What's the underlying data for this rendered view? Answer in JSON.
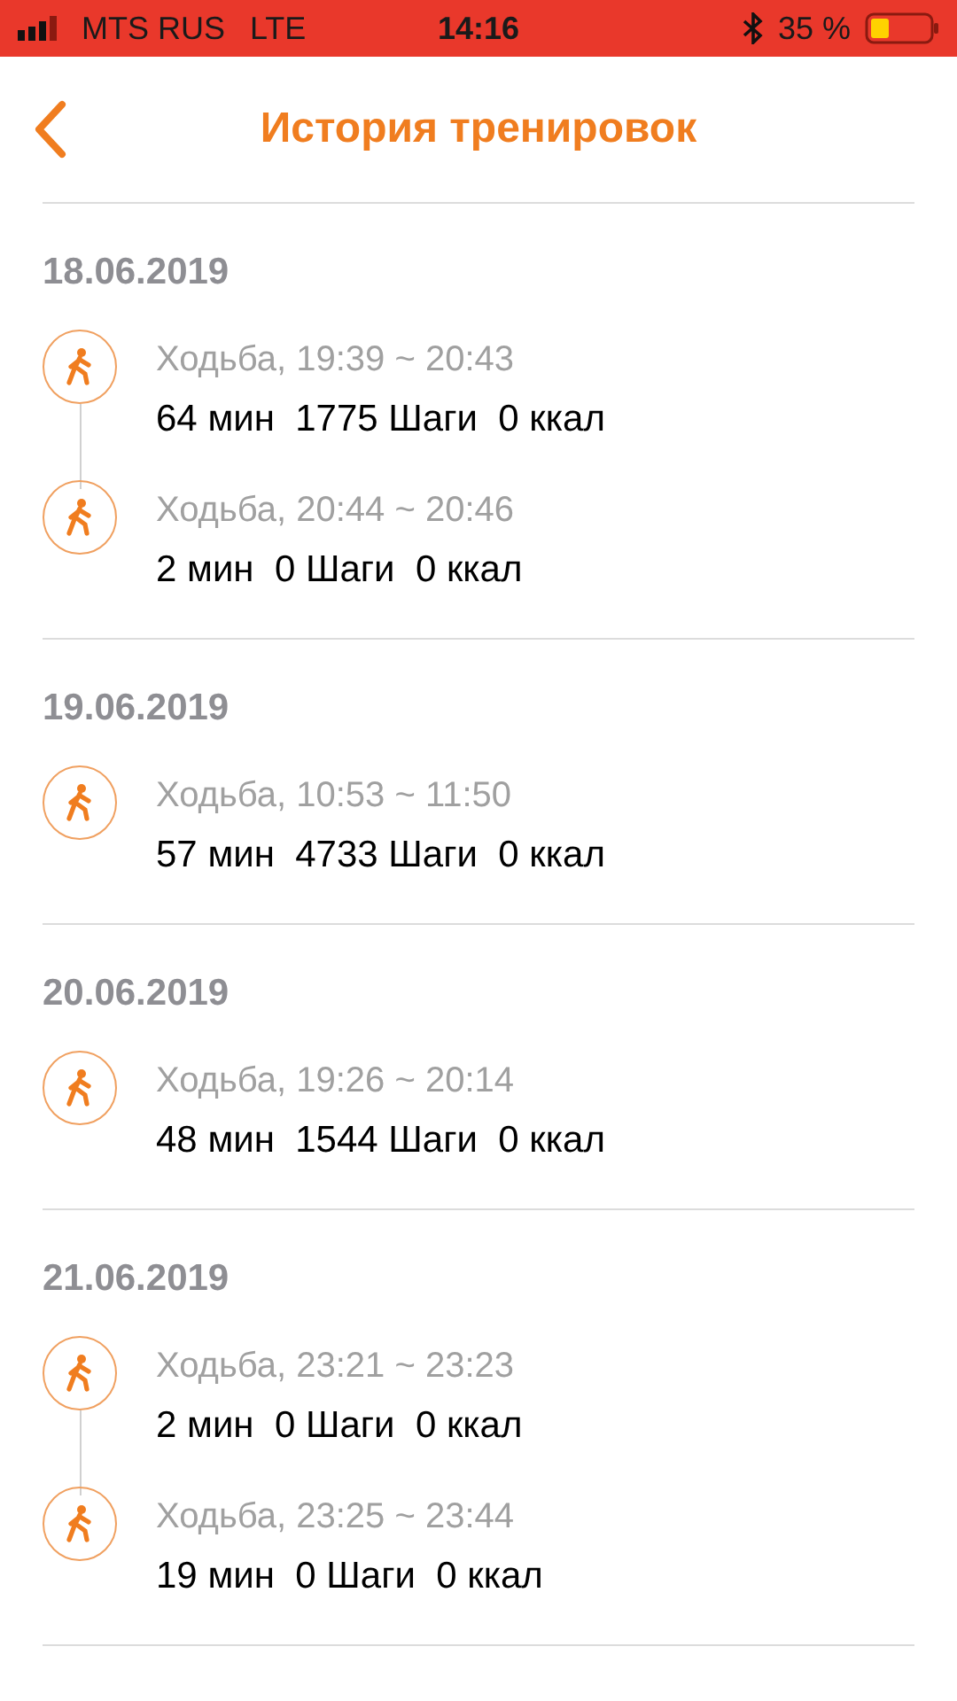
{
  "status_bar": {
    "carrier": "MTS RUS",
    "network": "LTE",
    "time": "14:16",
    "battery": "35 %"
  },
  "header": {
    "title": "История тренировок"
  },
  "sections": [
    {
      "date": "18.06.2019",
      "items": [
        {
          "title": "Ходьба, 19:39 ~ 20:43",
          "stats": "64 мин  1775 Шаги  0 ккал"
        },
        {
          "title": "Ходьба, 20:44 ~ 20:46",
          "stats": "2 мин  0 Шаги  0 ккал"
        }
      ]
    },
    {
      "date": "19.06.2019",
      "items": [
        {
          "title": "Ходьба, 10:53 ~ 11:50",
          "stats": "57 мин  4733 Шаги  0 ккал"
        }
      ]
    },
    {
      "date": "20.06.2019",
      "items": [
        {
          "title": "Ходьба, 19:26 ~ 20:14",
          "stats": "48 мин  1544 Шаги  0 ккал"
        }
      ]
    },
    {
      "date": "21.06.2019",
      "items": [
        {
          "title": "Ходьба, 23:21 ~ 23:23",
          "stats": "2 мин  0 Шаги  0 ккал"
        },
        {
          "title": "Ходьба, 23:25 ~ 23:44",
          "stats": "19 мин  0 Шаги  0 ккал"
        }
      ]
    }
  ]
}
